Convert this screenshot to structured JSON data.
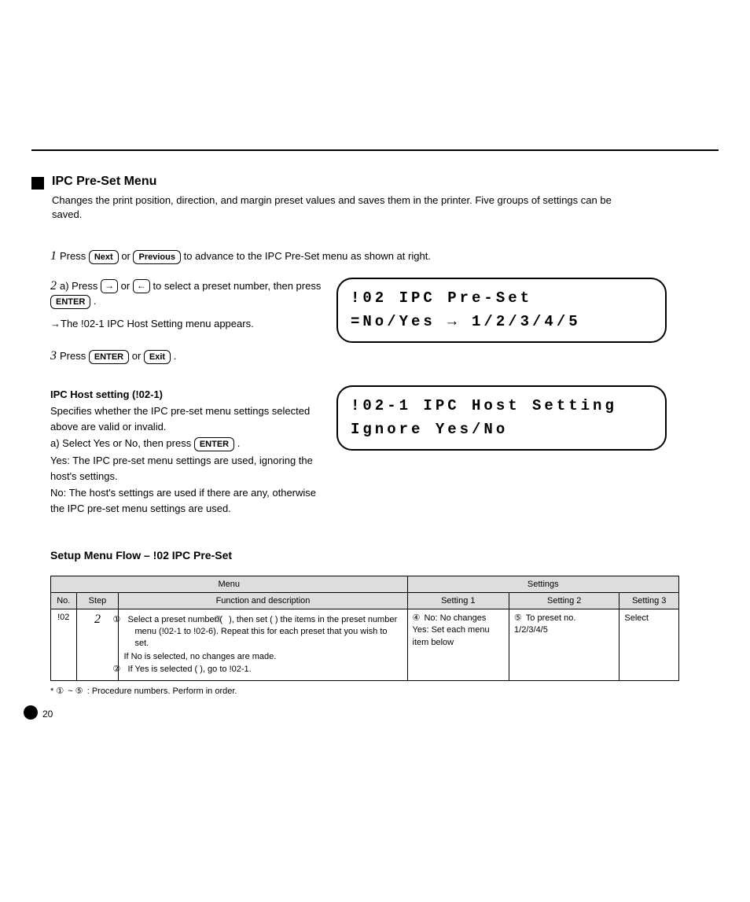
{
  "section": {
    "title": "IPC Pre-Set Menu",
    "intro": "Changes the print position, direction, and margin preset values and saves them in the printer. Five groups of settings can be saved."
  },
  "step1": {
    "lead_before": "Press ",
    "key_next": "Next",
    "lead_mid1": " or ",
    "key_prev": "Previous",
    "lead_after": " to advance to the IPC Pre-Set menu as shown at right."
  },
  "step2": {
    "part_a_before": "a) Press ",
    "part_a_mid": " or ",
    "part_a_after": " to select a preset number, then press ",
    "part_a_end": ".",
    "key_enter": "ENTER",
    "part_b_after": "→The !02-1 IPC Host Setting menu appears."
  },
  "lcd1": {
    "line1": "!02 IPC Pre-Set",
    "line2": " =No/Yes → 1/2/3/4/5"
  },
  "step3": {
    "before": "Press ",
    "key_enter": "ENTER",
    "mid": " or ",
    "key_exit": "Exit",
    "after": "."
  },
  "sub": {
    "title": "IPC Host setting (!02-1)",
    "desc": "Specifies whether the IPC pre-set menu settings selected above are valid or invalid.",
    "step_a": "a) Select Yes or No, then press ",
    "key_enter": "ENTER",
    "step_a_end": ".",
    "yes_means": "Yes: The IPC pre-set menu settings are used, ignoring the host's settings.",
    "no_means": "No: The host's settings are used if there are any, otherwise the IPC pre-set menu settings are used."
  },
  "lcd2": {
    "line1": "!02-1 IPC Host Setting",
    "line2": "    Ignore  Yes/No"
  },
  "table": {
    "title": "Setup Menu Flow – !02 IPC Pre-Set",
    "head_menu": "Menu",
    "head_settings": "Settings",
    "sub_no": "No.",
    "sub_step": "Step",
    "sub_desc": "Function and description",
    "sub_s1": "Setting 1",
    "sub_s2": "Setting 2",
    "sub_s3": "Setting 3",
    "row": {
      "no": "!02",
      "step": "2",
      "desc_line1_a": "Select a preset number (",
      "desc_line1_b": "), then set (",
      "desc_line1_c": ") the items in the preset number menu (!02-1 to !02-6). Repeat this for each preset that you wish to set.",
      "desc_line2": "If No is selected, no changes are made.",
      "desc_line3_a": "If Yes is selected (",
      "desc_line3_b": "), go to !02-1.",
      "set1_a": "No: No changes",
      "set1_b": "Yes: Set each menu item below",
      "set2_a": "To preset no.",
      "set2_b": "1/2/3/4/5",
      "set3": "Select"
    },
    "footnote_before": "* ",
    "footnote_mid": " ~ ",
    "footnote_after": " : Procedure numbers. Perform in order."
  },
  "page_number": "20"
}
